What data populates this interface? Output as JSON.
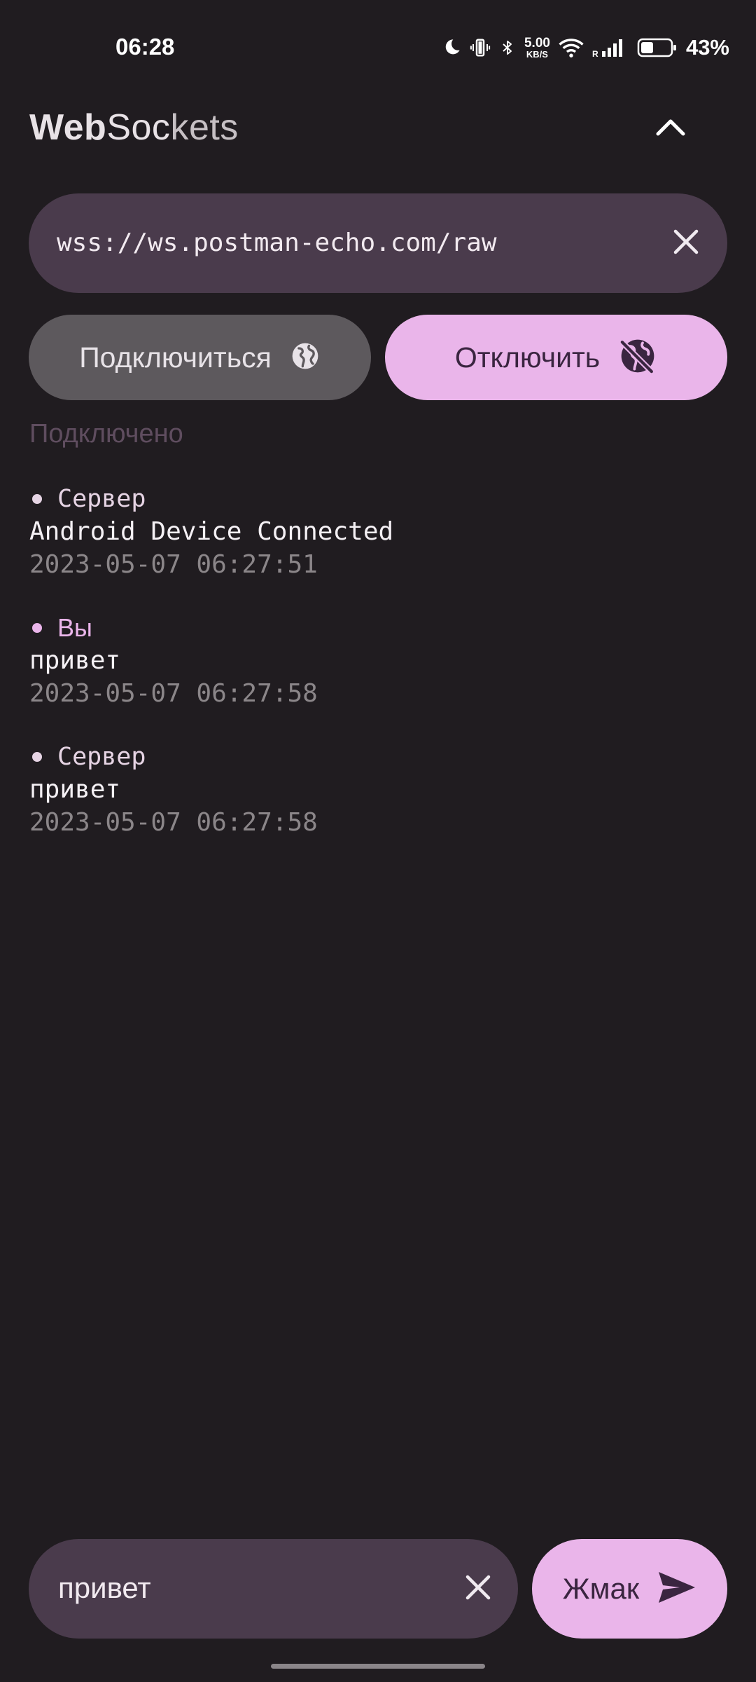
{
  "status_bar": {
    "time": "06:28",
    "net_speed_value": "5.00",
    "net_speed_unit": "KB/S",
    "battery_percent": "43%",
    "battery_level": 0.43,
    "icons": [
      "moon-icon",
      "vibrate-icon",
      "bluetooth-icon",
      "wifi-icon",
      "signal-icon",
      "battery-icon"
    ]
  },
  "header": {
    "title_part1": "Web",
    "title_part2": "Soc",
    "title_part3": "kets",
    "collapse_icon": "chevron-up-icon"
  },
  "url_field": {
    "value": "wss://ws.postman-echo.com/raw",
    "clear_icon": "close-icon"
  },
  "actions": {
    "connect_label": "Подключиться",
    "connect_icon": "globe-icon",
    "disconnect_label": "Отключить",
    "disconnect_icon": "globe-off-icon"
  },
  "connection_status": "Подключено",
  "messages": [
    {
      "sender": "Сервер",
      "text": "Android Device Connected",
      "time": "2023-05-07 06:27:51"
    },
    {
      "sender": "Вы",
      "text": "привет",
      "time": "2023-05-07 06:27:58"
    },
    {
      "sender": "Сервер",
      "text": "привет",
      "time": "2023-05-07 06:27:58"
    }
  ],
  "composer": {
    "value": "привет",
    "clear_icon": "close-icon",
    "send_label": "Жмак",
    "send_icon": "send-icon"
  },
  "colors": {
    "background": "#201c20",
    "field": "#4a3b4c",
    "accent": "#eab5ea",
    "secondary_button": "#5d595d",
    "muted_text": "#8b8689"
  }
}
